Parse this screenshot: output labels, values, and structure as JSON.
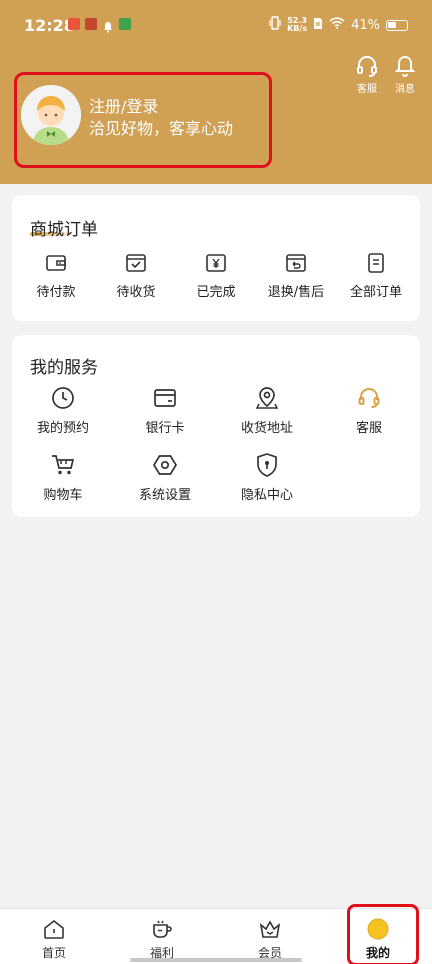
{
  "status_bar": {
    "time": "12:28",
    "net_speed_value": "52.3",
    "net_speed_unit": "KB/s",
    "battery": "41%"
  },
  "header": {
    "customer_service_label": "客服",
    "messages_label": "消息",
    "bg_color": "#d0a055"
  },
  "profile": {
    "title": "注册/登录",
    "subtitle": "洽见好物，客享心动"
  },
  "orders": {
    "title": "商城订单",
    "items": [
      {
        "label": "待付款",
        "icon": "wallet-icon"
      },
      {
        "label": "待收货",
        "icon": "package-check-icon"
      },
      {
        "label": "已完成",
        "icon": "yen-receipt-icon"
      },
      {
        "label": "退换/售后",
        "icon": "return-icon"
      },
      {
        "label": "全部订单",
        "icon": "order-list-icon"
      }
    ]
  },
  "services": {
    "title": "我的服务",
    "items": [
      {
        "label": "我的预约",
        "icon": "clock-icon"
      },
      {
        "label": "银行卡",
        "icon": "bank-card-icon"
      },
      {
        "label": "收货地址",
        "icon": "location-pin-icon"
      },
      {
        "label": "客服",
        "icon": "headset-icon"
      },
      {
        "label": "购物车",
        "icon": "shopping-cart-icon"
      },
      {
        "label": "系统设置",
        "icon": "settings-hexagon-icon"
      },
      {
        "label": "隐私中心",
        "icon": "shield-lock-icon"
      }
    ]
  },
  "tabbar": {
    "items": [
      {
        "label": "首页",
        "icon": "home-icon"
      },
      {
        "label": "福利",
        "icon": "cup-icon"
      },
      {
        "label": "会员",
        "icon": "crown-icon"
      },
      {
        "label": "我的",
        "icon": "profile-dot-icon"
      }
    ],
    "active_index": 3,
    "accent": "#f4c320"
  }
}
